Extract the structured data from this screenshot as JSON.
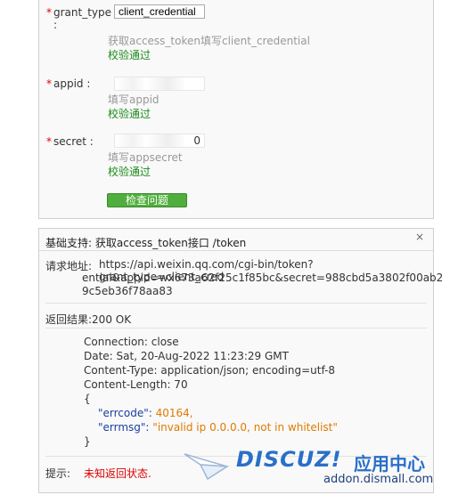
{
  "form": {
    "grant_type": {
      "label": "grant_type",
      "colon": ":",
      "value": "client_credential",
      "hint": "获取access_token填写client_credential",
      "status": "校验通过"
    },
    "appid": {
      "label": "appid :",
      "hint": "填写appid",
      "status": "校验通过"
    },
    "secret": {
      "label": "secret :",
      "value_tail": "0",
      "hint": "填写appsecret",
      "status": "校验通过"
    },
    "required_mark": "*",
    "check_button": "检查问题"
  },
  "result": {
    "title": "基础支持: 获取access_token接口 /token",
    "close": "×",
    "request_label": "请求地址:",
    "request_line1": "https://api.weixin.qq.com/cgi-bin/token?grant_type=client_cred",
    "request_line2": "ential&appid=wx673a62f25c1f85bc&secret=988cbd5a3802f00ab2",
    "request_line3": "9c5eb36f78aa83",
    "response_label": "返回结果:200 OK",
    "headers": [
      "Connection: close",
      "Date: Sat, 20-Aug-2022 11:23:29 GMT",
      "Content-Type: application/json; encoding=utf-8",
      "Content-Length: 70"
    ],
    "json_open": "{",
    "errcode_key": "\"errcode\":",
    "errcode_val": "40164,",
    "errmsg_key": "\"errmsg\":",
    "errmsg_val": "\"invalid ip 0.0.0.0, not in whitelist\"",
    "json_close": "}",
    "tip_label": "提示:",
    "tip_value": "未知返回状态."
  },
  "watermark": {
    "brand": "DISCUZ!",
    "brand_cn": "应用中心",
    "url": "addon.dismall.com",
    "colors": {
      "blue": "#2a6fc9",
      "dark": "#1d3f7a"
    }
  }
}
